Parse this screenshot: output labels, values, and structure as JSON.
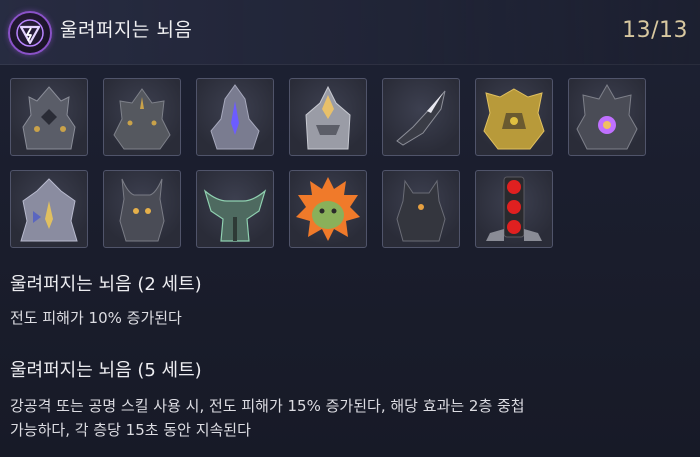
{
  "header": {
    "title": "울려퍼지는 뇌음",
    "count": "13/13",
    "emblem_icon": "lightning-triangle-emblem-icon",
    "accent_color": "#8a52c8"
  },
  "items": [
    {
      "name": "armor-piece-1-icon",
      "accent": "#c9a24a"
    },
    {
      "name": "armor-piece-2-icon",
      "accent": "#c9a24a"
    },
    {
      "name": "armor-piece-3-icon",
      "accent": "#6c5cff"
    },
    {
      "name": "armor-piece-4-icon",
      "accent": "#e8c06a"
    },
    {
      "name": "armor-piece-5-icon",
      "accent": "#e8e8f0"
    },
    {
      "name": "armor-piece-6-icon",
      "accent": "#e0c040"
    },
    {
      "name": "armor-piece-7-icon",
      "accent": "#c070ff"
    },
    {
      "name": "armor-piece-8-icon",
      "accent": "#e0c060"
    },
    {
      "name": "armor-piece-9-icon",
      "accent": "#e6b04a"
    },
    {
      "name": "armor-piece-10-icon",
      "accent": "#8fd0b0"
    },
    {
      "name": "armor-piece-11-icon",
      "accent": "#f07a2a"
    },
    {
      "name": "armor-piece-12-icon",
      "accent": "#e6a040"
    },
    {
      "name": "armor-piece-13-icon",
      "accent": "#e02020"
    }
  ],
  "sets": [
    {
      "title": "울려퍼지는 뇌음 (2 세트)",
      "description": [
        "전도 피해가 10% 증가된다"
      ]
    },
    {
      "title": "울려퍼지는 뇌음 (5 세트)",
      "description": [
        "강공격 또는 공명 스킬 사용 시, 전도 피해가 15% 증가된다, 해당 효과는 2층 중첩",
        "가능하다, 각 층당 15초 동안 지속된다"
      ]
    }
  ]
}
